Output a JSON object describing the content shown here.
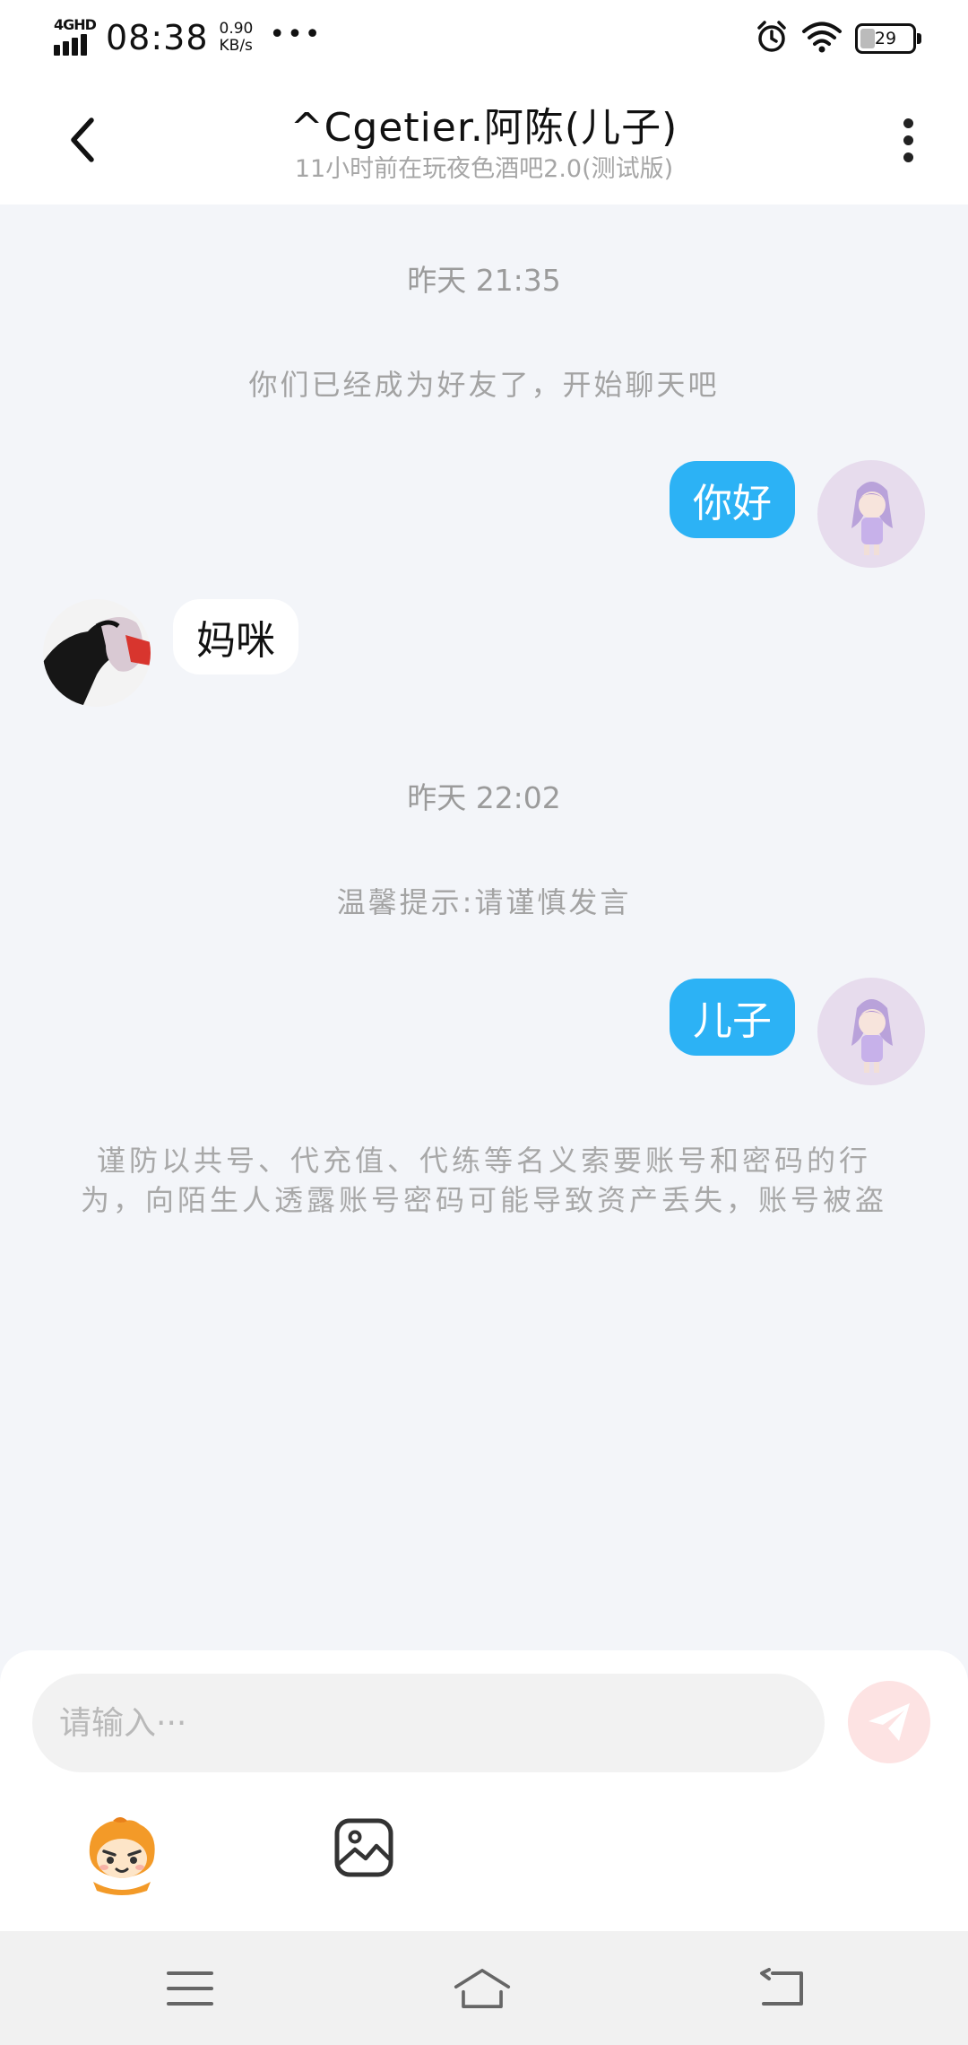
{
  "status_bar": {
    "network": "4GHD",
    "time": "08:38",
    "speed_value": "0.90",
    "speed_unit": "KB/s",
    "more": "•••",
    "battery": "29",
    "icons": [
      "alarm-icon",
      "wifi-icon",
      "battery-icon"
    ]
  },
  "header": {
    "title": "^Cgetier.阿陈(儿子)",
    "subtitle": "11小时前在玩夜色酒吧2.0(测试版)",
    "icons": [
      "back-arrow-icon",
      "more-vertical-icon"
    ]
  },
  "messages": {
    "ts1": "昨天 21:35",
    "sys1": "你们已经成为好友了，开始聊天吧",
    "out1": "你好",
    "in1": "妈咪",
    "ts2": "昨天 22:02",
    "sys2": "温馨提示:请谨慎发言",
    "out2": "儿子",
    "warning": "谨防以共号、代充值、代练等名义索要账号和密码的行为，向陌生人透露账号密码可能导致资产丢失，账号被盗"
  },
  "input": {
    "placeholder": "请输入···",
    "value": "",
    "icons": [
      "send-icon",
      "emoji-icon",
      "image-icon"
    ]
  },
  "nav": {
    "icons": [
      "menu-icon",
      "home-icon",
      "back-icon"
    ]
  },
  "colors": {
    "outgoing_bubble": "#2cb2f5",
    "incoming_bubble": "#ffffff",
    "chat_background": "#f3f5f9",
    "send_button": "#fde3e3"
  }
}
